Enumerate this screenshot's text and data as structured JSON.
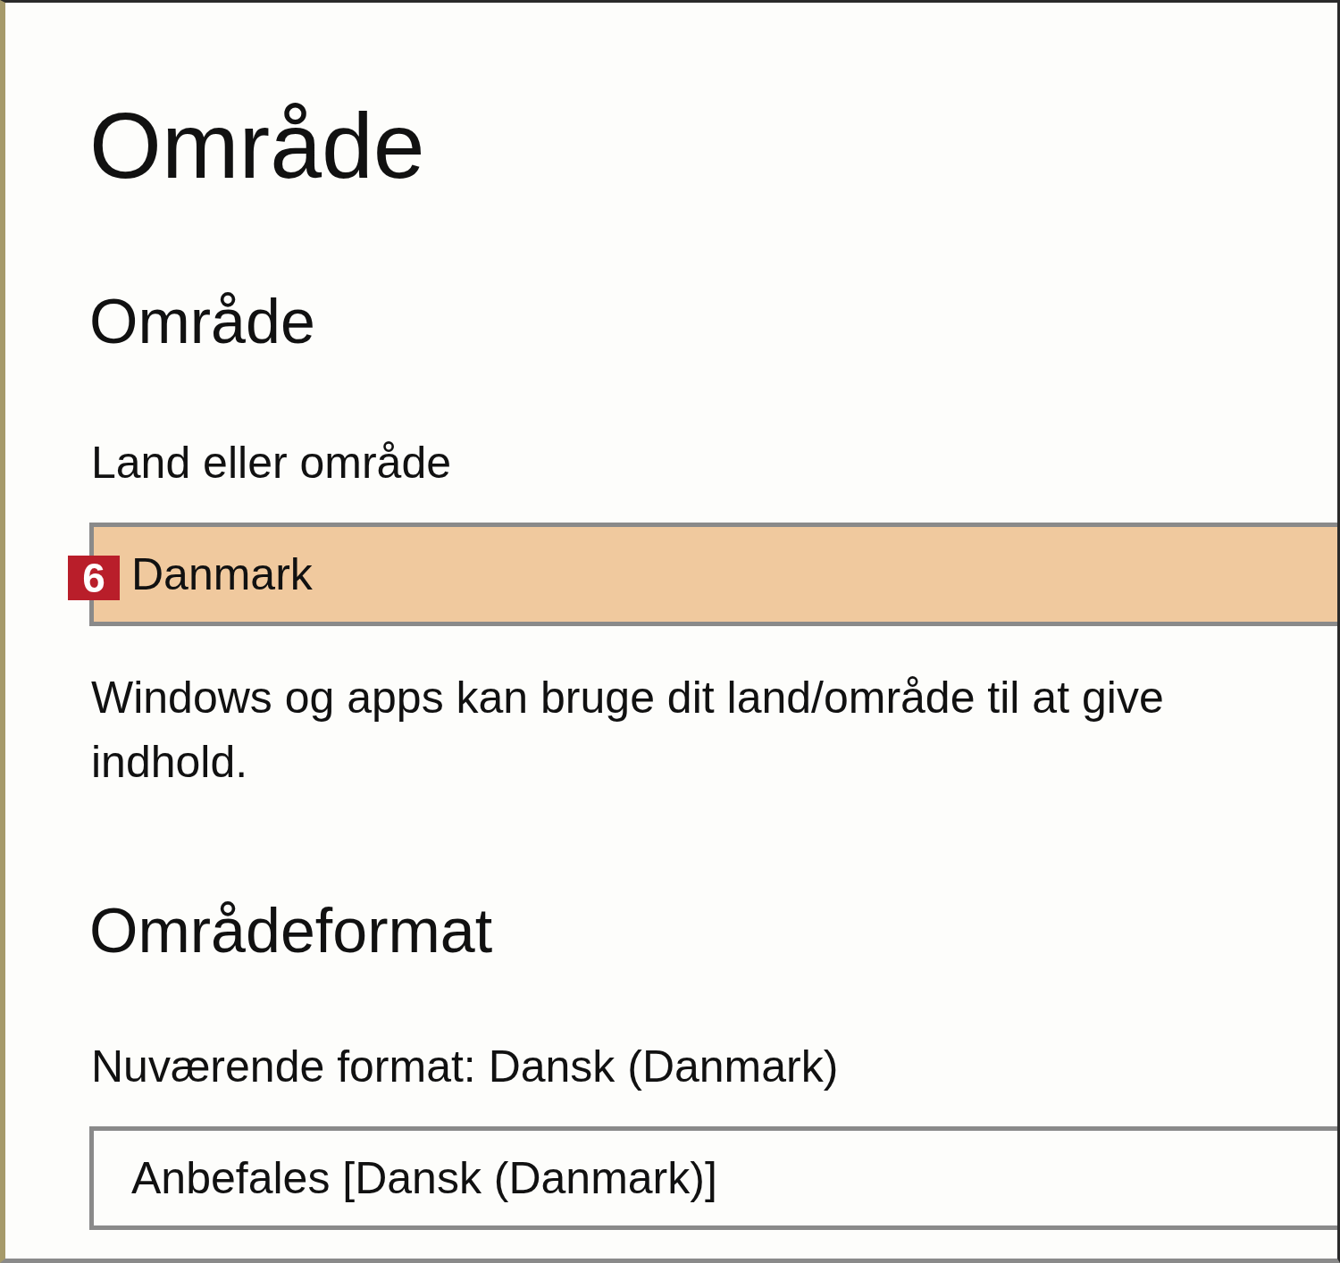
{
  "page": {
    "title": "Område"
  },
  "region": {
    "heading": "Område",
    "label": "Land eller område",
    "field": {
      "value": "Danmark",
      "highlighted": true,
      "badge": "6"
    },
    "description": "Windows og apps kan bruge dit land/område til at give\nindhold."
  },
  "format": {
    "heading": "Områdeformat",
    "label": "Nuværende format: Dansk (Danmark)",
    "field": {
      "value": "Anbefales [Dansk (Danmark)]",
      "highlighted": false
    }
  }
}
